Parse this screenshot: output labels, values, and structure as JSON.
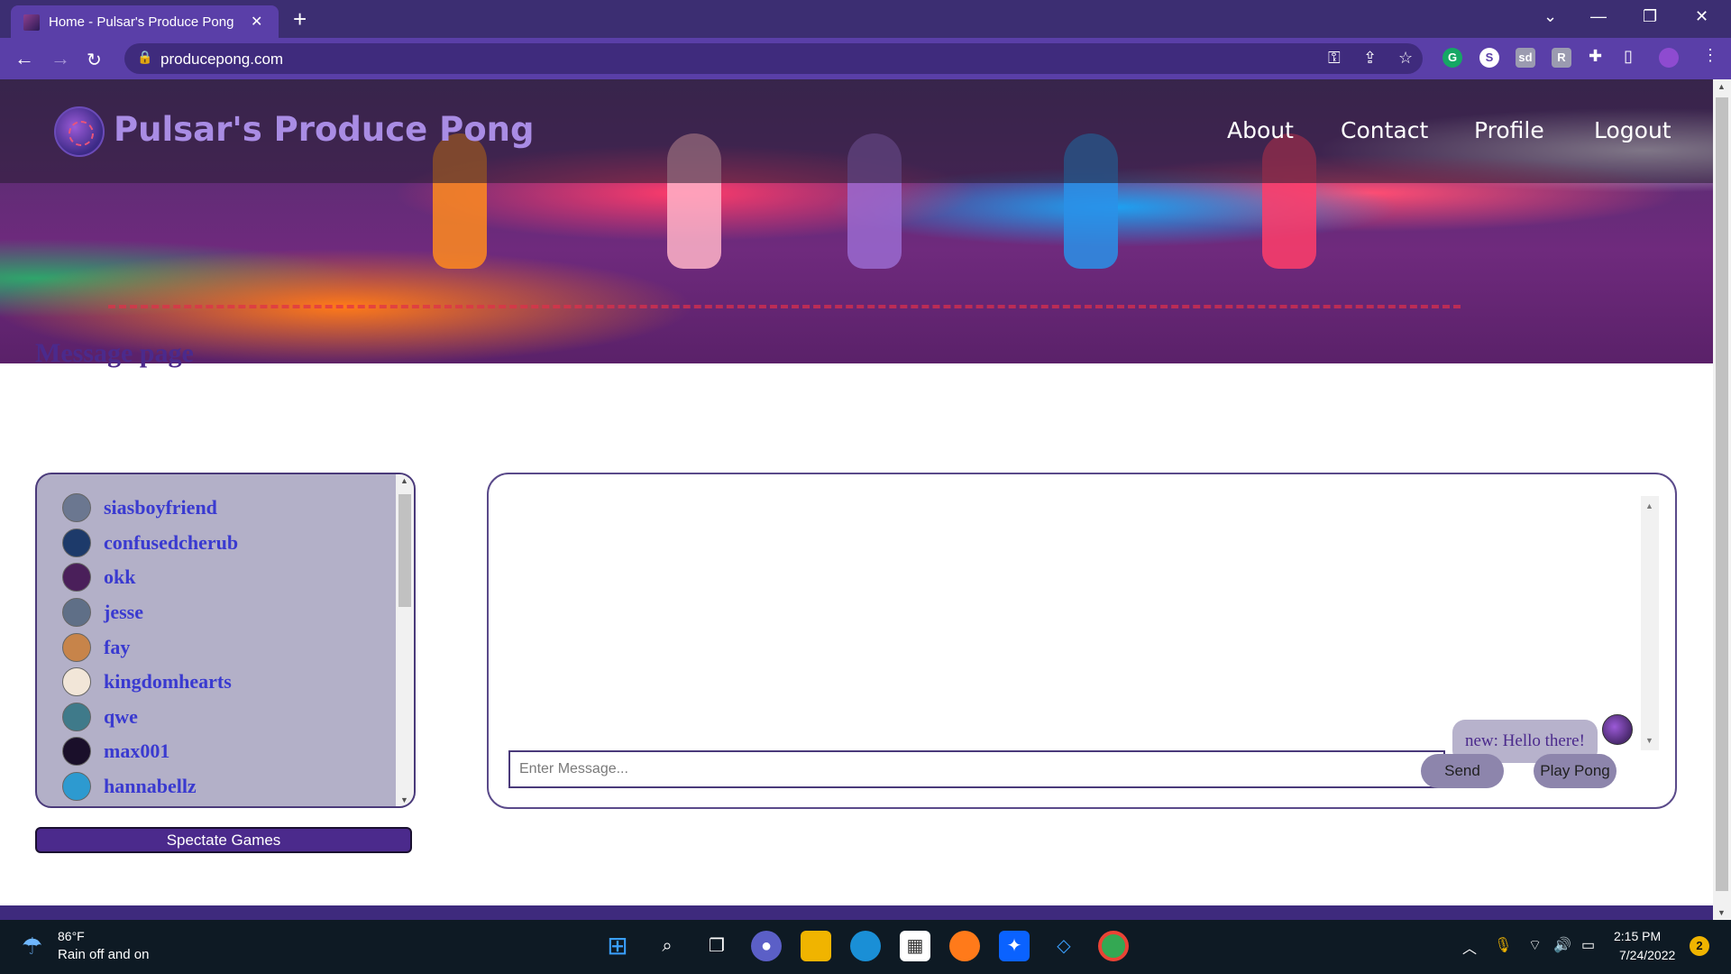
{
  "browser": {
    "tab_title": "Home - Pulsar's Produce Pong",
    "tab_close": "✕",
    "new_tab": "+",
    "url": "producepong.com",
    "window_controls": {
      "tab_search": "⌄",
      "minimize": "—",
      "restore": "❐",
      "close": "✕"
    },
    "extensions": [
      "G",
      "S",
      "sd",
      "R"
    ]
  },
  "site": {
    "title": "Pulsar's Produce Pong",
    "nav": [
      "About",
      "Contact",
      "Profile",
      "Logout"
    ]
  },
  "messages": {
    "page_title": "Message page",
    "users": [
      {
        "name": "siasboyfriend",
        "avatar_color": "#6b7790"
      },
      {
        "name": "confusedcherub",
        "avatar_color": "#1d3a6a"
      },
      {
        "name": "okk",
        "avatar_color": "#4a1f5a"
      },
      {
        "name": "jesse",
        "avatar_color": "#5f6f87"
      },
      {
        "name": "fay",
        "avatar_color": "#c7844a"
      },
      {
        "name": "kingdomhearts",
        "avatar_color": "#f2e6d8"
      },
      {
        "name": "qwe",
        "avatar_color": "#3f7a8a"
      },
      {
        "name": "max001",
        "avatar_color": "#1a0f2a"
      },
      {
        "name": "hannabellz",
        "avatar_color": "#2d9ad0"
      }
    ],
    "spectate_label": "Spectate Games",
    "chat": {
      "bubble_text": "new: Hello there!",
      "input_placeholder": "Enter Message...",
      "send_label": "Send",
      "play_label": "Play Pong"
    }
  },
  "taskbar": {
    "weather_temp": "86°F",
    "weather_desc": "Rain off and on",
    "time": "2:15 PM",
    "date": "7/24/2022",
    "notifications": "2"
  },
  "colors": {
    "brand_purple": "#4b2a8c",
    "title_lavender": "#a98ce4",
    "user_link_blue": "#3a3ad0",
    "list_bg": "#b3b0c8",
    "button_gray_purple": "#8d85ac"
  }
}
